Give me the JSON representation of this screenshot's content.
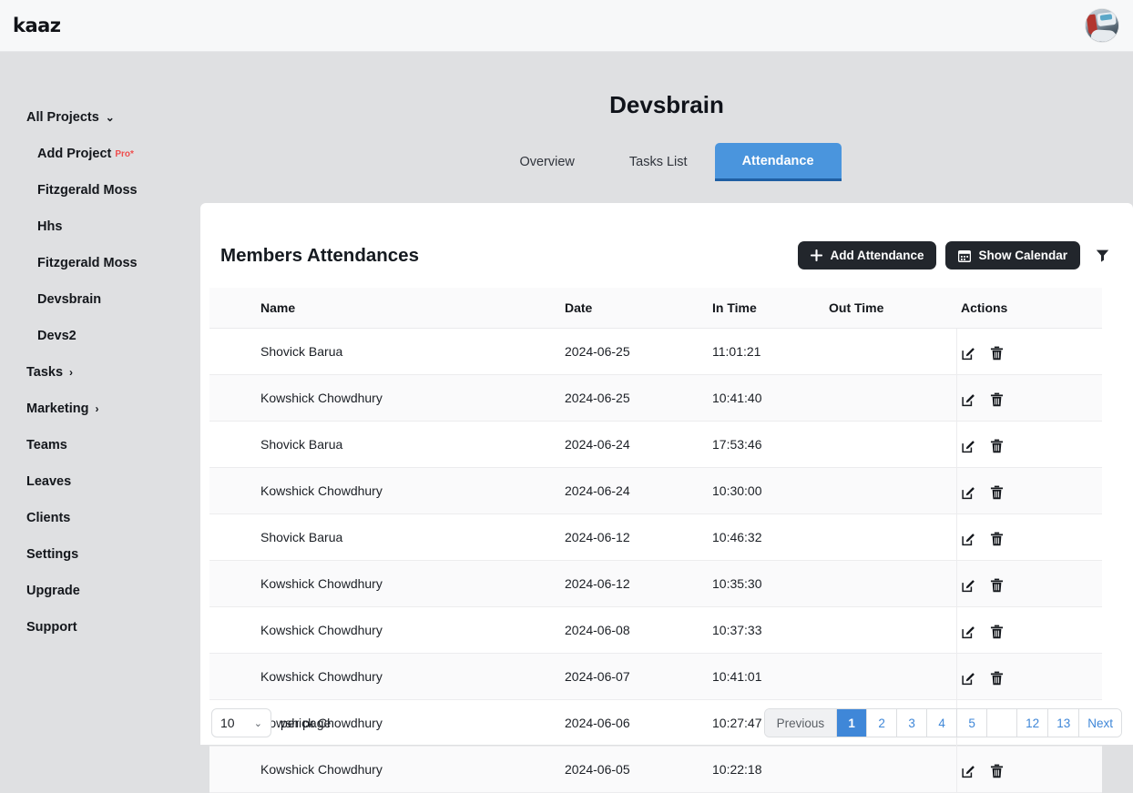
{
  "topbar": {
    "brand": "kaaz",
    "avatar_alt": "user-avatar"
  },
  "sidebar": {
    "header": {
      "label": "All Projects",
      "chevron": "⌄"
    },
    "items": [
      {
        "label": "Add Project",
        "badge": "Pro*",
        "sub": true
      },
      {
        "label": "Fitzgerald Moss",
        "sub": true
      },
      {
        "label": "Hhs",
        "sub": true
      },
      {
        "label": "Fitzgerald Moss",
        "sub": true
      },
      {
        "label": "Devsbrain",
        "sub": true
      },
      {
        "label": "Devs2",
        "sub": true
      },
      {
        "label": "Tasks",
        "chevron": "›",
        "sub": false
      },
      {
        "label": "Marketing",
        "chevron": "›",
        "sub": false
      },
      {
        "label": "Teams",
        "sub": false
      },
      {
        "label": "Leaves",
        "sub": false
      },
      {
        "label": "Clients",
        "sub": false
      },
      {
        "label": "Settings",
        "sub": false
      },
      {
        "label": "Upgrade",
        "sub": false
      },
      {
        "label": "Support",
        "sub": false
      }
    ]
  },
  "main": {
    "page_title": "Devsbrain",
    "tabs": [
      {
        "label": "Overview",
        "active": false
      },
      {
        "label": "Tasks List",
        "active": false
      },
      {
        "label": "Attendance",
        "active": true
      }
    ]
  },
  "card": {
    "title": "Members Attendances",
    "add_attendance_label": "Add Attendance",
    "show_calendar_label": "Show Calendar",
    "filter_label": "Filter"
  },
  "table": {
    "columns": [
      "Name",
      "Date",
      "In Time",
      "Out Time",
      "Actions"
    ],
    "rows": [
      {
        "name": "Shovick Barua",
        "date": "2024-06-25",
        "in_time": "11:01:21",
        "out_time": ""
      },
      {
        "name": "Kowshick Chowdhury",
        "date": "2024-06-25",
        "in_time": "10:41:40",
        "out_time": ""
      },
      {
        "name": "Shovick Barua",
        "date": "2024-06-24",
        "in_time": "17:53:46",
        "out_time": ""
      },
      {
        "name": "Kowshick Chowdhury",
        "date": "2024-06-24",
        "in_time": "10:30:00",
        "out_time": ""
      },
      {
        "name": "Shovick Barua",
        "date": "2024-06-12",
        "in_time": "10:46:32",
        "out_time": ""
      },
      {
        "name": "Kowshick Chowdhury",
        "date": "2024-06-12",
        "in_time": "10:35:30",
        "out_time": ""
      },
      {
        "name": "Kowshick Chowdhury",
        "date": "2024-06-08",
        "in_time": "10:37:33",
        "out_time": ""
      },
      {
        "name": "Kowshick Chowdhury",
        "date": "2024-06-07",
        "in_time": "10:41:01",
        "out_time": ""
      },
      {
        "name": "Kowshick Chowdhury",
        "date": "2024-06-06",
        "in_time": "10:27:47",
        "out_time": ""
      },
      {
        "name": "Kowshick Chowdhury",
        "date": "2024-06-05",
        "in_time": "10:22:18",
        "out_time": ""
      }
    ]
  },
  "footer": {
    "per_page_value": "10",
    "per_page_label": "per page",
    "per_page_chevron": "⌄",
    "pagination": [
      {
        "label": "Previous",
        "kind": "prev"
      },
      {
        "label": "1",
        "kind": "active"
      },
      {
        "label": "2",
        "kind": "page"
      },
      {
        "label": "3",
        "kind": "page"
      },
      {
        "label": "4",
        "kind": "page"
      },
      {
        "label": "5",
        "kind": "page"
      },
      {
        "label": "",
        "kind": "gap"
      },
      {
        "label": "12",
        "kind": "page"
      },
      {
        "label": "13",
        "kind": "page"
      },
      {
        "label": "Next",
        "kind": "page"
      }
    ]
  },
  "colors": {
    "accent_blue": "#3f87d8",
    "tab_blue": "#4a95dd",
    "dark_button": "#22262c",
    "pro_red": "#ef4d4d",
    "page_bg": "#dfe0e2"
  }
}
